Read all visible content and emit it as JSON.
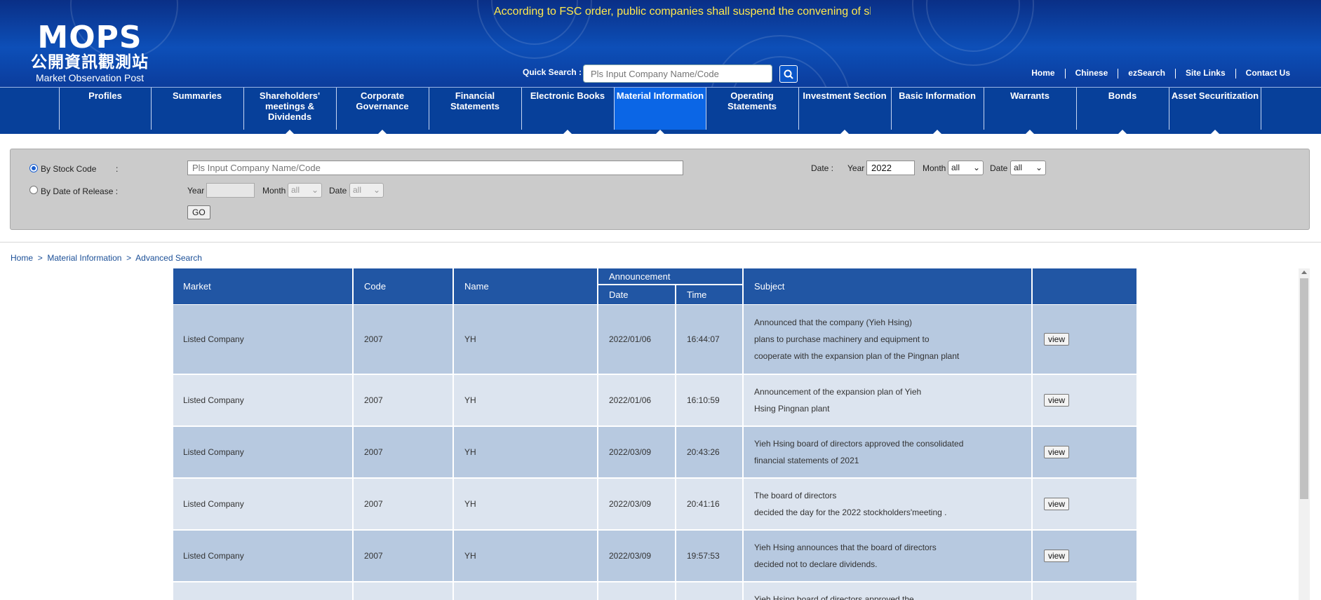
{
  "header": {
    "ticker": "According to FSC order, public companies shall suspend the convening of sl",
    "logo_big": "MOPS",
    "logo_cn": "公開資訊觀測站",
    "logo_en": "Market Observation Post System",
    "quick_search_label": "Quick Search :",
    "quick_search_placeholder": "Pls Input Company Name/Code",
    "links": [
      "Home",
      "Chinese",
      "ezSearch",
      "Site Links",
      "Contact Us"
    ]
  },
  "nav": {
    "items": [
      {
        "label": "Profiles",
        "arrow": false
      },
      {
        "label": "Summaries",
        "arrow": false
      },
      {
        "label": "Shareholders' meetings & Dividends",
        "arrow": true
      },
      {
        "label": "Corporate Governance",
        "arrow": true
      },
      {
        "label": "Financial Statements",
        "arrow": false
      },
      {
        "label": "Electronic Books",
        "arrow": true
      },
      {
        "label": "Material Information",
        "arrow": true,
        "active": true
      },
      {
        "label": "Operating Statements",
        "arrow": false
      },
      {
        "label": "Investment Section",
        "arrow": true
      },
      {
        "label": "Basic Information",
        "arrow": true
      },
      {
        "label": "Warrants",
        "arrow": true
      },
      {
        "label": "Bonds",
        "arrow": true
      },
      {
        "label": "Asset Securitization",
        "arrow": true
      }
    ]
  },
  "search": {
    "by_stock_code": "By Stock Code",
    "colon": ":",
    "by_date_release": "By Date of Release :",
    "company_placeholder": "Pls Input Company Name/Code",
    "date_label": "Date :",
    "year_label": "Year",
    "year_value": "2022",
    "month_label": "Month",
    "month_value": "all",
    "date_sel_label": "Date",
    "date_value": "all",
    "year2_label": "Year",
    "month2_label": "Month",
    "month2_value": "all",
    "date2_label": "Date",
    "date2_value": "all",
    "go_label": "GO"
  },
  "breadcrumb": [
    "Home",
    "Material Information",
    "Advanced Search"
  ],
  "table": {
    "headers": {
      "market": "Market",
      "code": "Code",
      "name": "Name",
      "announcement": "Announcement",
      "date": "Date",
      "time": "Time",
      "subject": "Subject"
    },
    "view_label": "view",
    "rows": [
      {
        "market": "Listed Company",
        "code": "2007",
        "name": "YH",
        "date": "2022/01/06",
        "time": "16:44:07",
        "subject": [
          "Announced that the company (Yieh Hsing)",
          "plans to purchase machinery and equipment to",
          "cooperate with the expansion plan of the Pingnan plant"
        ]
      },
      {
        "market": "Listed Company",
        "code": "2007",
        "name": "YH",
        "date": "2022/01/06",
        "time": "16:10:59",
        "subject": [
          "Announcement of the expansion plan of Yieh",
          "Hsing Pingnan plant"
        ]
      },
      {
        "market": "Listed Company",
        "code": "2007",
        "name": "YH",
        "date": "2022/03/09",
        "time": "20:43:26",
        "subject": [
          "Yieh Hsing board of directors approved the consolidated",
          "financial statements of 2021"
        ]
      },
      {
        "market": "Listed Company",
        "code": "2007",
        "name": "YH",
        "date": "2022/03/09",
        "time": "20:41:16",
        "subject": [
          "The board of directors",
          "decided the day for the 2022 stockholders'meeting ."
        ]
      },
      {
        "market": "Listed Company",
        "code": "2007",
        "name": "YH",
        "date": "2022/03/09",
        "time": "19:57:53",
        "subject": [
          "Yieh Hsing announces that the board of directors",
          "decided  not to declare dividends."
        ]
      },
      {
        "market": "",
        "code": "",
        "name": "",
        "date": "",
        "time": "",
        "subject": [
          "Yieh Hsing board of directors approved the"
        ],
        "partial": true
      }
    ]
  },
  "colors": {
    "header_blue": "#2156a4",
    "row_dark": "#b7c9e0",
    "row_light": "#dce4ef",
    "nav_blue": "#07409a",
    "active_nav": "#0b66e6",
    "ticker_yellow": "#ffe94d"
  }
}
